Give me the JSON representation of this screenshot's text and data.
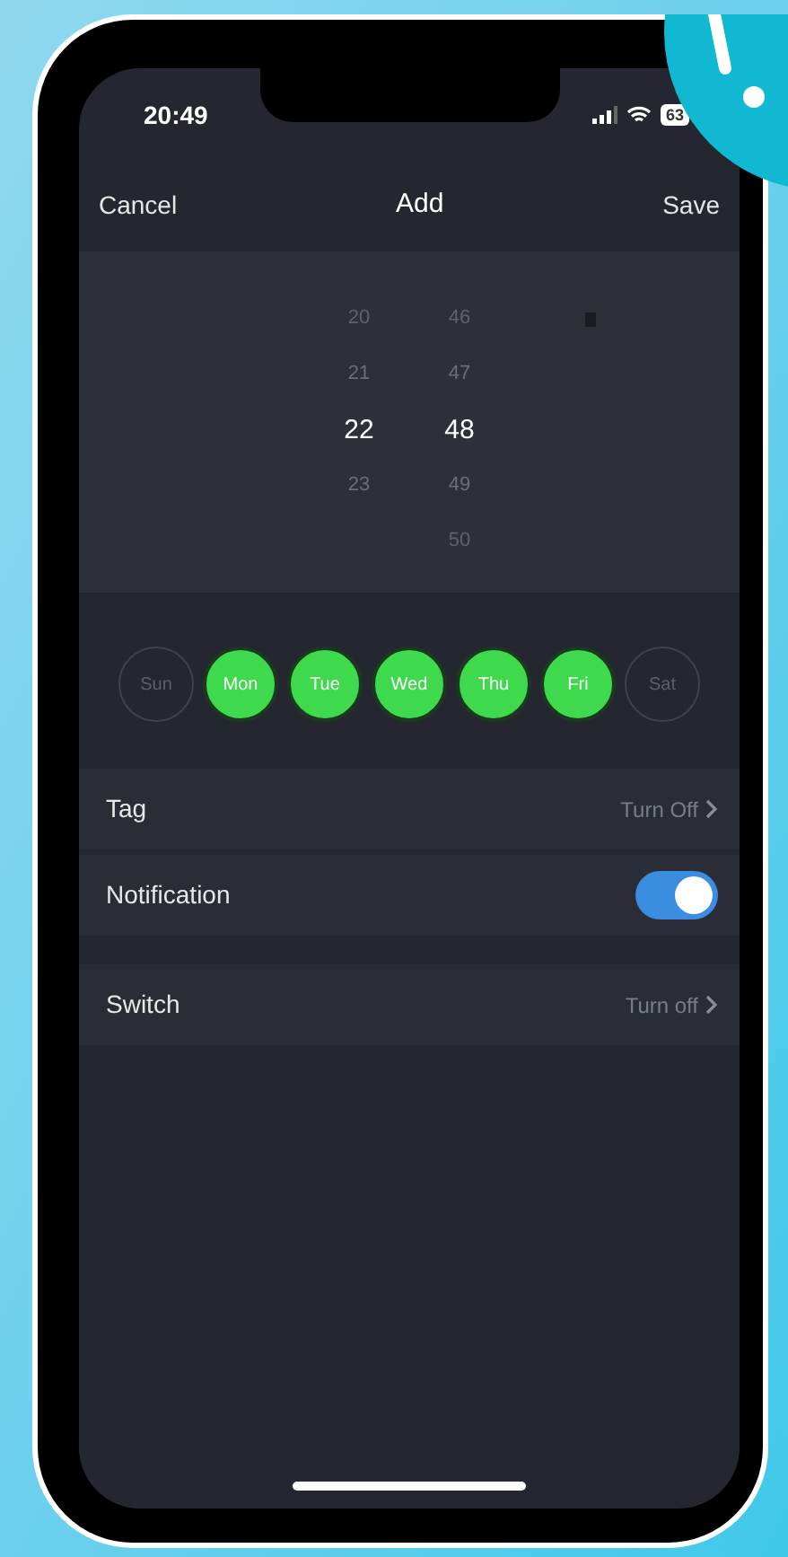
{
  "status_bar": {
    "time": "20:49",
    "battery": "63"
  },
  "nav": {
    "cancel": "Cancel",
    "title": "Add",
    "save": "Save"
  },
  "picker": {
    "hours": [
      {
        "label": "20",
        "selected": false
      },
      {
        "label": "21",
        "selected": false
      },
      {
        "label": "22",
        "selected": true
      },
      {
        "label": "23",
        "selected": false
      }
    ],
    "minutes": [
      {
        "label": "46",
        "selected": false
      },
      {
        "label": "47",
        "selected": false
      },
      {
        "label": "48",
        "selected": true
      },
      {
        "label": "49",
        "selected": false
      },
      {
        "label": "50",
        "selected": false
      }
    ]
  },
  "days": [
    {
      "label": "Sun",
      "selected": false
    },
    {
      "label": "Mon",
      "selected": true
    },
    {
      "label": "Tue",
      "selected": true
    },
    {
      "label": "Wed",
      "selected": true
    },
    {
      "label": "Thu",
      "selected": true
    },
    {
      "label": "Fri",
      "selected": true
    },
    {
      "label": "Sat",
      "selected": false
    }
  ],
  "settings_groups": [
    [
      {
        "kind": "link",
        "label": "Tag",
        "value": "Turn Off"
      },
      {
        "kind": "toggle",
        "label": "Notification",
        "on": true
      }
    ],
    [
      {
        "kind": "link",
        "label": "Switch",
        "value": "Turn off"
      }
    ]
  ]
}
